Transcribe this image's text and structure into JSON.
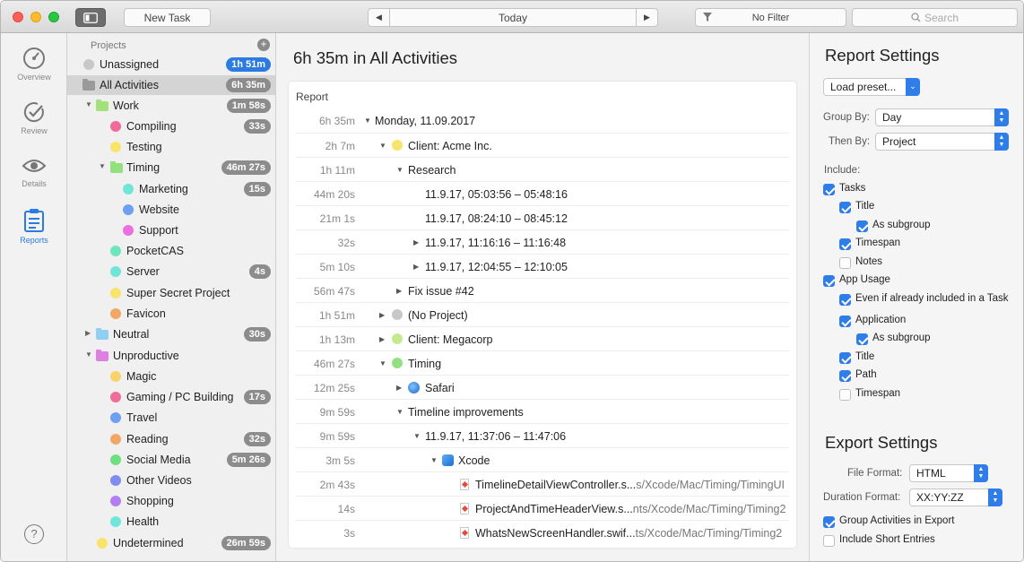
{
  "toolbar": {
    "new_task": "New Task",
    "date_nav": "Today",
    "filter": "No Filter",
    "search_placeholder": "Search"
  },
  "rail": {
    "items": [
      {
        "label": "Overview",
        "icon": "gauge-icon"
      },
      {
        "label": "Review",
        "icon": "checkmark-circle-icon"
      },
      {
        "label": "Details",
        "icon": "eye-icon"
      },
      {
        "label": "Reports",
        "icon": "clipboard-icon"
      }
    ],
    "help": "?"
  },
  "sidebar": {
    "header": "Projects",
    "items": [
      {
        "label": "Unassigned",
        "badge": "1h 51m",
        "color": "#c8c8c8"
      },
      {
        "label": "All Activities",
        "badge": "6h 35m"
      },
      {
        "label": "Work",
        "badge": "1m 58s",
        "color": "#a3e27b"
      },
      {
        "label": "Compiling",
        "badge": "33s",
        "color": "#f06a9a"
      },
      {
        "label": "Testing",
        "color": "#f7e46a"
      },
      {
        "label": "Timing",
        "badge": "46m 27s",
        "color": "#93e07f"
      },
      {
        "label": "Marketing",
        "badge": "15s",
        "color": "#6fe6d9"
      },
      {
        "label": "Website",
        "color": "#6f9ff0"
      },
      {
        "label": "Support",
        "color": "#ea6fe0"
      },
      {
        "label": "PocketCAS",
        "color": "#6fe6c0"
      },
      {
        "label": "Server",
        "badge": "4s",
        "color": "#6fe6d9"
      },
      {
        "label": "Super Secret Project",
        "color": "#f7e46a"
      },
      {
        "label": "Favicon",
        "color": "#f2a768"
      },
      {
        "label": "Neutral",
        "badge": "30s",
        "color": "#8fd0f2"
      },
      {
        "label": "Unproductive",
        "color": "#e07fe2"
      },
      {
        "label": "Magic",
        "color": "#f7d36a"
      },
      {
        "label": "Gaming / PC Building",
        "badge": "17s",
        "color": "#f06a9a"
      },
      {
        "label": "Travel",
        "color": "#6f9ff0"
      },
      {
        "label": "Reading",
        "badge": "32s",
        "color": "#f2a768"
      },
      {
        "label": "Social Media",
        "badge": "5m 26s",
        "color": "#6fe07f"
      },
      {
        "label": "Other Videos",
        "color": "#7f8cf0"
      },
      {
        "label": "Shopping",
        "color": "#b27ff0"
      },
      {
        "label": "Health",
        "color": "#6fe6d9"
      },
      {
        "label": "Undetermined",
        "badge": "26m 59s",
        "color": "#f7e46a"
      }
    ]
  },
  "main": {
    "title": "6h 35m in All Activities",
    "report_label": "Report",
    "rows": [
      {
        "dur": "6h 35m",
        "text": "Monday, 11.09.2017"
      },
      {
        "dur": "2h 7m",
        "text": "Client: Acme Inc.",
        "color": "#f7e46a"
      },
      {
        "dur": "1h 11m",
        "text": "Research"
      },
      {
        "dur": "44m 20s",
        "text": "11.9.17, 05:03:56 – 05:48:16"
      },
      {
        "dur": "21m 1s",
        "text": "11.9.17, 08:24:10 – 08:45:12"
      },
      {
        "dur": "32s",
        "text": "11.9.17, 11:16:16 – 11:16:48"
      },
      {
        "dur": "5m 10s",
        "text": "11.9.17, 12:04:55 – 12:10:05"
      },
      {
        "dur": "56m 47s",
        "text": "Fix issue #42"
      },
      {
        "dur": "1h 51m",
        "text": "(No Project)",
        "color": "#c8c8c8"
      },
      {
        "dur": "1h 13m",
        "text": "Client: Megacorp",
        "color": "#c4ea8e"
      },
      {
        "dur": "46m 27s",
        "text": "Timing",
        "color": "#93e07f"
      },
      {
        "dur": "12m 25s",
        "text": "Safari"
      },
      {
        "dur": "9m 59s",
        "text": "Timeline improvements"
      },
      {
        "dur": "9m 59s",
        "text": "11.9.17, 11:37:06 – 11:47:06"
      },
      {
        "dur": "3m 5s",
        "text": "Xcode"
      },
      {
        "dur": "2m 43s",
        "text": "TimelineDetailViewController.s...",
        "path": "s/Xcode/Mac/Timing/TimingUI"
      },
      {
        "dur": "14s",
        "text": "ProjectAndTimeHeaderView.s...",
        "path": "nts/Xcode/Mac/Timing/Timing2"
      },
      {
        "dur": "3s",
        "text": "WhatsNewScreenHandler.swif...",
        "path": "ts/Xcode/Mac/Timing/Timing2"
      }
    ]
  },
  "report_settings": {
    "title": "Report Settings",
    "load_preset": "Load preset...",
    "group_by_label": "Group By:",
    "group_by_value": "Day",
    "then_by_label": "Then By:",
    "then_by_value": "Project",
    "include_label": "Include:",
    "checks": [
      {
        "label": "Tasks",
        "on": true
      },
      {
        "label": "Title",
        "on": true
      },
      {
        "label": "As subgroup",
        "on": true
      },
      {
        "label": "Timespan",
        "on": true
      },
      {
        "label": "Notes",
        "on": false
      },
      {
        "label": "App Usage",
        "on": true
      },
      {
        "label": "Even if already included in a Task",
        "on": true
      },
      {
        "label": "Application",
        "on": true
      },
      {
        "label": "As subgroup",
        "on": true
      },
      {
        "label": "Title",
        "on": true
      },
      {
        "label": "Path",
        "on": true
      },
      {
        "label": "Timespan",
        "on": false
      }
    ]
  },
  "export_settings": {
    "title": "Export Settings",
    "file_format_label": "File Format:",
    "file_format_value": "HTML",
    "duration_format_label": "Duration Format:",
    "duration_format_value": "XX:YY:ZZ",
    "checks": [
      {
        "label": "Group Activities in Export",
        "on": true
      },
      {
        "label": "Include Short Entries",
        "on": false
      }
    ]
  }
}
